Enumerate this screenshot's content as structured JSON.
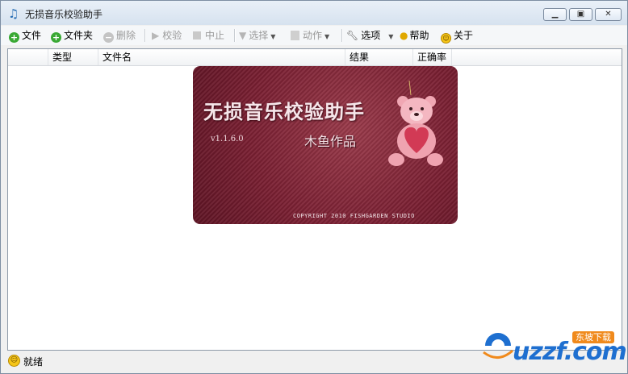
{
  "window": {
    "title": "无损音乐校验助手"
  },
  "toolbar": {
    "file": "文件",
    "folder": "文件夹",
    "delete": "删除",
    "verify": "校验",
    "stop": "中止",
    "select": "选择",
    "action": "动作",
    "options": "选项",
    "help": "帮助",
    "about": "关于"
  },
  "table": {
    "columns": [
      "类型",
      "文件名",
      "结果",
      "正确率"
    ]
  },
  "splash": {
    "title": "无损音乐校验助手",
    "version": "v1.1.6.0",
    "author": "木鱼作品",
    "copyright": "COPYRIGHT 2010 FISHGARDEN STUDIO"
  },
  "status": {
    "text": "就绪"
  },
  "watermark": {
    "text": "uzzf.com",
    "tag": "东坡下载"
  },
  "colors": {
    "accent": "#1e6fd0",
    "splash_bg": "#7a1f32",
    "add_icon": "#3aa935"
  }
}
